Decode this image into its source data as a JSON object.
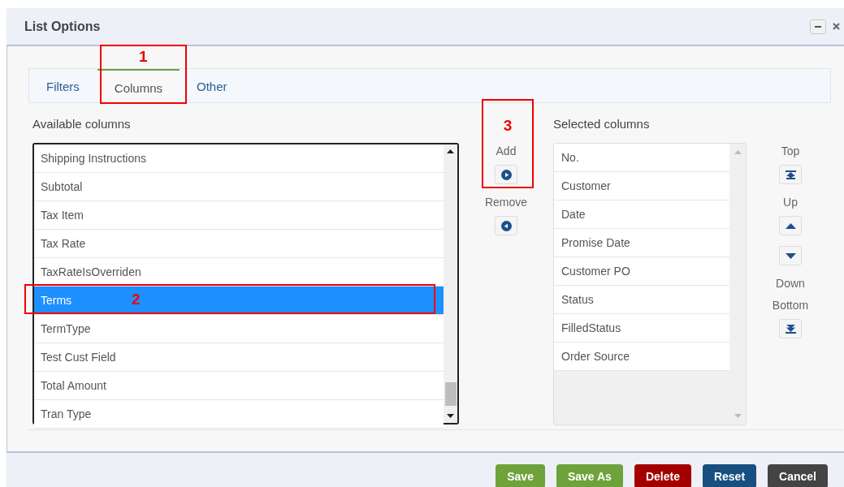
{
  "window": {
    "title": "List Options"
  },
  "tabs": [
    {
      "label": "Filters",
      "selected": false
    },
    {
      "label": "Columns",
      "selected": true,
      "callout": "1"
    },
    {
      "label": "Other",
      "selected": false
    }
  ],
  "available_columns": {
    "label": "Available columns",
    "items": [
      {
        "label": "Shipping Instructions",
        "selected": false
      },
      {
        "label": "Subtotal",
        "selected": false
      },
      {
        "label": "Tax Item",
        "selected": false
      },
      {
        "label": "Tax Rate",
        "selected": false
      },
      {
        "label": "TaxRateIsOverriden",
        "selected": false
      },
      {
        "label": "Terms",
        "selected": true,
        "callout": "2"
      },
      {
        "label": "TermType",
        "selected": false
      },
      {
        "label": "Test Cust Field",
        "selected": false
      },
      {
        "label": "Total Amount",
        "selected": false
      },
      {
        "label": "Tran Type",
        "selected": false
      }
    ]
  },
  "transfer": {
    "callout": "3",
    "actions": [
      {
        "label": "Add",
        "kind": "add"
      },
      {
        "label": "Remove",
        "kind": "remove"
      }
    ]
  },
  "selected_columns": {
    "label": "Selected columns",
    "items": [
      "No.",
      "Customer",
      "Date",
      "Promise Date",
      "Customer PO",
      "Status",
      "FilledStatus",
      "Order Source"
    ]
  },
  "order_controls": [
    {
      "kind": "caption",
      "text": "Top"
    },
    {
      "kind": "top"
    },
    {
      "kind": "caption",
      "text": "Up"
    },
    {
      "kind": "up"
    },
    {
      "kind": "down"
    },
    {
      "kind": "caption",
      "text": "Down"
    },
    {
      "kind": "caption",
      "text": "Bottom"
    },
    {
      "kind": "bottom"
    }
  ],
  "footer_buttons": [
    {
      "label": "Save",
      "color": "#6ea23a"
    },
    {
      "label": "Save As",
      "color": "#6ea23a"
    },
    {
      "label": "Delete",
      "color": "#a50000"
    },
    {
      "label": "Reset",
      "color": "#174f80"
    },
    {
      "label": "Cancel",
      "color": "#444444"
    }
  ]
}
